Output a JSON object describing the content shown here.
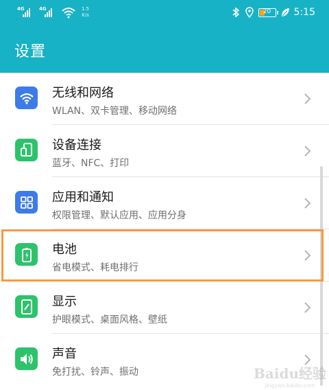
{
  "status_bar": {
    "signal_1_label": "4G",
    "signal_2_label": "4G",
    "speed_value": "1.5",
    "speed_unit": "K/s",
    "battery_level": "20",
    "time": "5:15"
  },
  "header": {
    "title": "设置"
  },
  "settings_items": [
    {
      "title": "无线和网络",
      "subtitle": "WLAN、双卡管理、移动网络",
      "icon": "wifi-icon",
      "icon_color": "#3d7be8"
    },
    {
      "title": "设备连接",
      "subtitle": "蓝牙、NFC、打印",
      "icon": "device-connection-icon",
      "icon_color": "#2cc36b"
    },
    {
      "title": "应用和通知",
      "subtitle": "权限管理、默认应用、应用分身",
      "icon": "apps-grid-icon",
      "icon_color": "#3d7be8"
    },
    {
      "title": "电池",
      "subtitle": "省电模式、耗电排行",
      "icon": "battery-icon",
      "icon_color": "#2cc36b"
    },
    {
      "title": "显示",
      "subtitle": "护眼模式、桌面风格、壁纸",
      "icon": "display-icon",
      "icon_color": "#2cc36b"
    },
    {
      "title": "声音",
      "subtitle": "免打扰、铃声、振动",
      "icon": "speaker-icon",
      "icon_color": "#2cc36b"
    }
  ],
  "colors": {
    "accent": "#17b2c6",
    "highlight": "#f59a42"
  },
  "watermark": {
    "text": "Baidu经验",
    "url": "jingyan.baidu.com"
  }
}
